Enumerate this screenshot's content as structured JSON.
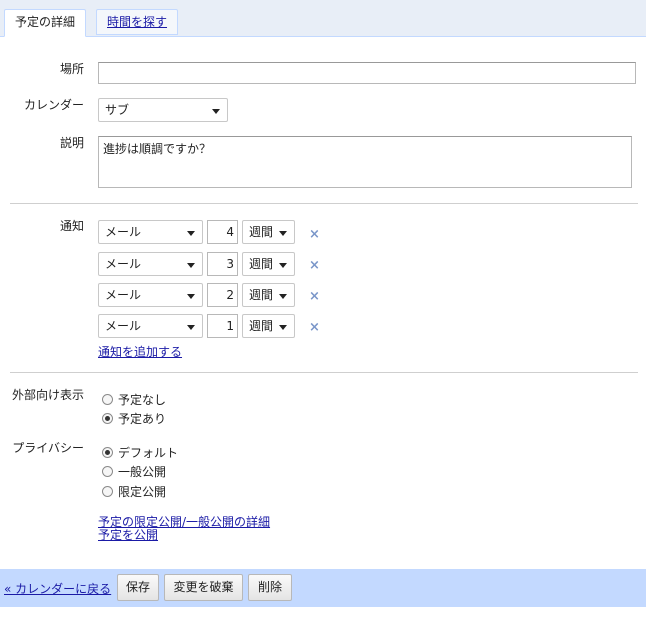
{
  "tabs": [
    {
      "label": "予定の詳細"
    },
    {
      "label": "時間を探す"
    }
  ],
  "location": {
    "label": "場所",
    "value": ""
  },
  "calendar": {
    "label": "カレンダー",
    "selected": "サブ"
  },
  "description": {
    "label": "説明",
    "value": "進捗は順調ですか？"
  },
  "notifications": {
    "label": "通知",
    "rows": [
      {
        "method": "メール",
        "amount": "4",
        "unit": "週間"
      },
      {
        "method": "メール",
        "amount": "3",
        "unit": "週間"
      },
      {
        "method": "メール",
        "amount": "2",
        "unit": "週間"
      },
      {
        "method": "メール",
        "amount": "1",
        "unit": "週間"
      }
    ],
    "add_link": "通知を追加する"
  },
  "show_as": {
    "label": "外部向け表示",
    "options": [
      "予定なし",
      "予定あり"
    ],
    "selected": "予定あり"
  },
  "privacy": {
    "label": "プライバシー",
    "options": [
      "デフォルト",
      "一般公開",
      "限定公開"
    ],
    "selected": "デフォルト",
    "details_link": "予定の限定公開/一般公開の詳細",
    "publish_link": "予定を公開"
  },
  "footer": {
    "back_link": "« カレンダーに戻る",
    "save": "保存",
    "discard": "変更を破棄",
    "delete": "削除"
  },
  "colors": {
    "accent": "#c3d9ff",
    "link": "#1a1aa6",
    "remove_x": "#7a96c9"
  }
}
